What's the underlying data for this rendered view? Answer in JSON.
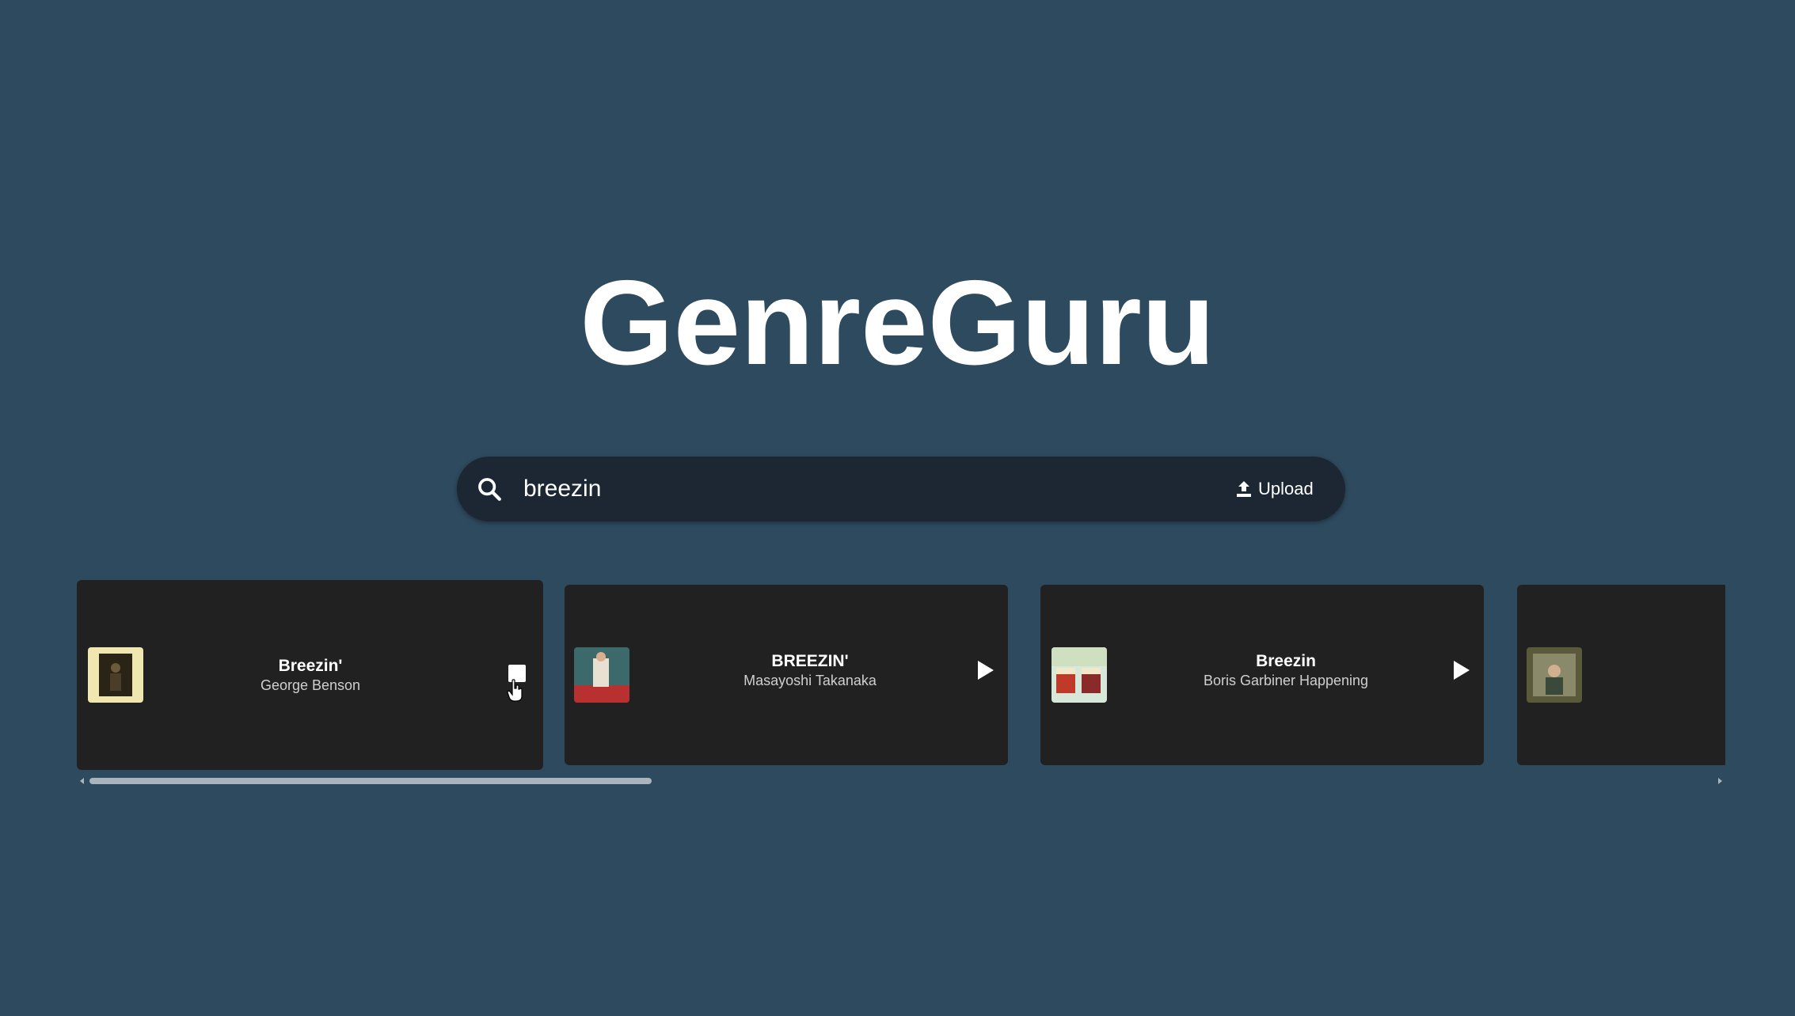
{
  "app": {
    "title": "GenreGuru"
  },
  "search": {
    "value": "breezin",
    "upload_label": "Upload"
  },
  "results": [
    {
      "title": "Breezin'",
      "artist": "George Benson",
      "state": "playing"
    },
    {
      "title": "BREEZIN'",
      "artist": "Masayoshi Takanaka",
      "state": "paused"
    },
    {
      "title": "Breezin",
      "artist": "Boris Garbiner Happening",
      "state": "paused"
    },
    {
      "title": "",
      "artist": "",
      "state": "paused"
    }
  ],
  "colors": {
    "background": "#2e4a5e",
    "search_bar": "#1c2733",
    "card": "#212121"
  }
}
